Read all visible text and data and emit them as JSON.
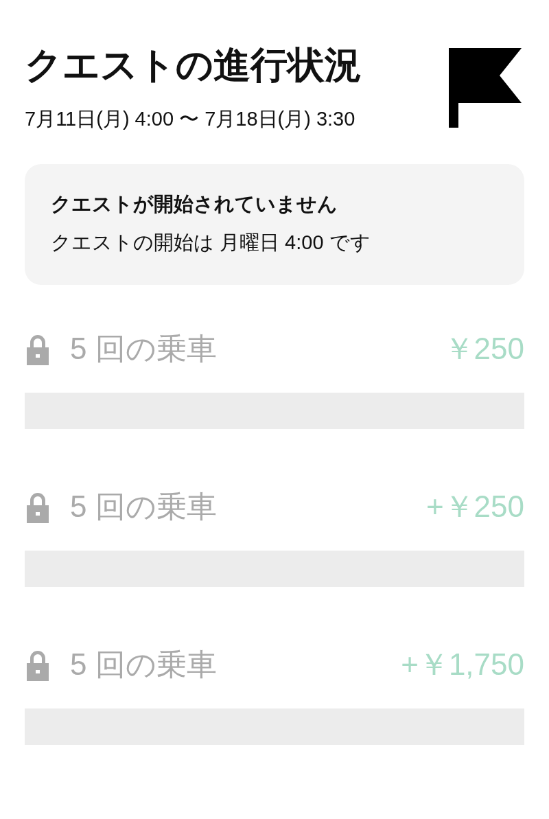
{
  "header": {
    "title": "クエストの進行状況",
    "period": "7月11日(月) 4:00 〜 7月18日(月) 3:30"
  },
  "notice": {
    "title": "クエストが開始されていません",
    "message": "クエストの開始は 月曜日 4:00 です"
  },
  "quests": [
    {
      "label": "5 回の乗車",
      "reward": "￥250",
      "locked": true,
      "level": 0
    },
    {
      "label": "5 回の乗車",
      "reward": "+￥250",
      "locked": true,
      "level": 0
    },
    {
      "label": "5 回の乗車",
      "reward": "+￥1,750",
      "locked": true,
      "level": 0
    }
  ]
}
